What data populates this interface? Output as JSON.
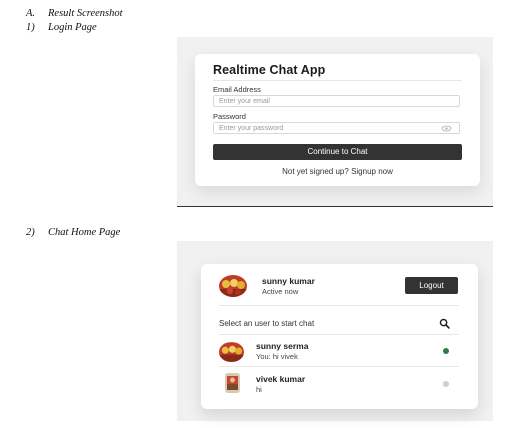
{
  "document": {
    "section_heading": {
      "num": "A.",
      "text": "Result Screenshot"
    },
    "item1": {
      "num": "1)",
      "text": "Login Page"
    },
    "item2": {
      "num": "2)",
      "text": "Chat Home Page"
    }
  },
  "login": {
    "title": "Realtime Chat App",
    "email_label": "Email Address",
    "email_placeholder": "Enter your email",
    "password_label": "Password",
    "password_placeholder": "Enter your password",
    "continue_button": "Continue to Chat",
    "signup_prompt": "Not yet signed up?",
    "signup_link": "Signup now"
  },
  "chat": {
    "current_user": {
      "name": "sunny kumar",
      "status": "Active now"
    },
    "logout_button": "Logout",
    "search_prompt": "Select an user to start chat",
    "users": [
      {
        "name": "sunny serma",
        "last_message": "You: hi vivek",
        "status_color": "#2e7d45"
      },
      {
        "name": "vivek kumar",
        "last_message": "hi",
        "status_color": "#cfcfcf"
      }
    ]
  },
  "colors": {
    "button_dark": "#333333",
    "online": "#2e7d45",
    "offline": "#cfcfcf"
  }
}
